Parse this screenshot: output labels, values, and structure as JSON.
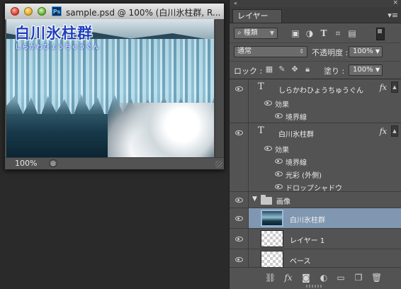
{
  "document": {
    "title": "sample.psd @ 100% (白川氷柱群, R...",
    "app_badge": "Ps",
    "canvas_title": "白川氷柱群",
    "canvas_subtitle": "しらかわひょうちゅうぐん",
    "zoom": "100%"
  },
  "panel": {
    "tab_label": "レイヤー",
    "filter_kind": "種類",
    "blend_mode": "通常",
    "opacity_label": "不透明度 :",
    "opacity_value": "100%",
    "lock_label": "ロック :",
    "fill_label": "塗り :",
    "fill_value": "100%",
    "fx_symbol": "fx"
  },
  "layers": [
    {
      "name": "しらかわひょうちゅうぐん",
      "type": "text",
      "effects_label": "効果",
      "effects": [
        "境界線"
      ]
    },
    {
      "name": "白川氷柱群",
      "type": "text",
      "effects_label": "効果",
      "effects": [
        "境界線",
        "光彩 (外側)",
        "ドロップシャドウ"
      ]
    },
    {
      "name": "画像",
      "type": "group"
    },
    {
      "name": "白川氷柱群",
      "type": "image",
      "selected": true
    },
    {
      "name": "レイヤー 1",
      "type": "raster"
    },
    {
      "name": "ベース",
      "type": "raster"
    }
  ],
  "colors": {
    "panel_bg": "#535353",
    "selected_row": "#8097b1",
    "canvas_title_color": "#1d3fbf"
  }
}
